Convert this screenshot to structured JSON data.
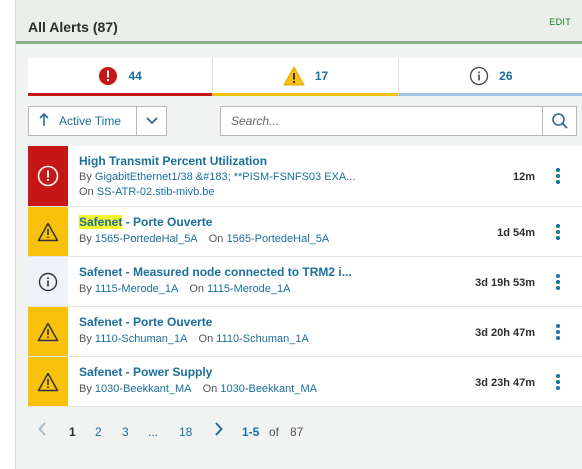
{
  "header": {
    "title": "All Alerts (87)",
    "edit_label": "EDIT"
  },
  "tabs": [
    {
      "severity": "critical",
      "count": "44",
      "icon": "error-circle-icon"
    },
    {
      "severity": "warning",
      "count": "17",
      "icon": "warning-triangle-icon"
    },
    {
      "severity": "info",
      "count": "26",
      "icon": "info-circle-icon"
    }
  ],
  "toolbar": {
    "sort_label": "Active Time",
    "search_placeholder": "Search..."
  },
  "alerts": [
    {
      "severity": "critical",
      "name": "High Transmit Percent Utilization",
      "by_label": "By",
      "by_value": "GigabitEthernet1/38 &#183; **PISM-FSNFS03 EXA...",
      "on_label": "On",
      "on_value": "SS-ATR-02.stib-mivb.be",
      "time": "12m"
    },
    {
      "severity": "warning",
      "name": "Safenet - Porte Ouverte",
      "name_highlight": "Safenet",
      "name_rest": " - Porte Ouverte",
      "by_label": "By",
      "by_value": "1565-PortedeHal_5A",
      "on_label": "On",
      "on_value": "1565-PortedeHal_5A",
      "time": "1d 54m"
    },
    {
      "severity": "info",
      "name": "Safenet - Measured node connected to TRM2 i...",
      "by_label": "By",
      "by_value": "1115-Merode_1A",
      "on_label": "On",
      "on_value": "1115-Merode_1A",
      "time": "3d 19h 53m"
    },
    {
      "severity": "warning",
      "name": "Safenet - Porte Ouverte",
      "by_label": "By",
      "by_value": "1110-Schuman_1A",
      "on_label": "On",
      "on_value": "1110-Schuman_1A",
      "time": "3d 20h 47m"
    },
    {
      "severity": "warning",
      "name": "Safenet - Power Supply",
      "by_label": "By",
      "by_value": "1030-Beekkant_MA",
      "on_label": "On",
      "on_value": "1030-Beekkant_MA",
      "time": "3d 23h 47m"
    }
  ],
  "pagination": {
    "pages": [
      "1",
      "2",
      "3",
      "...",
      "18"
    ],
    "current_page": "1",
    "range": "1-5",
    "of_label": "of",
    "total": "87"
  },
  "colors": {
    "critical": "#c61616",
    "warning": "#f7c10c",
    "info": "#9dc6e5",
    "link": "#1b6f9b",
    "highlight": "#f4f42b"
  }
}
